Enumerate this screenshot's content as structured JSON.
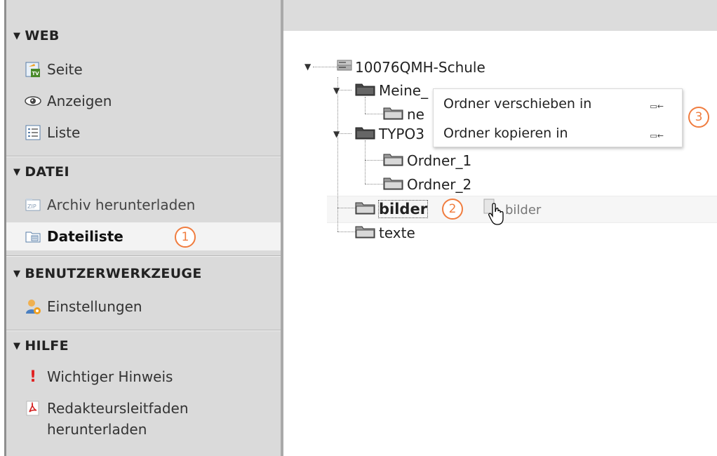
{
  "sidebar": {
    "sections": [
      {
        "title": "WEB",
        "items": [
          {
            "label": "Seite",
            "icon": "page-module-icon"
          },
          {
            "label": "Anzeigen",
            "icon": "eye-icon"
          },
          {
            "label": "Liste",
            "icon": "list-icon"
          }
        ]
      },
      {
        "title": "DATEI",
        "items": [
          {
            "label": "Archiv herunterladen",
            "icon": "zip-archive-icon"
          },
          {
            "label": "Dateiliste",
            "icon": "filelist-icon",
            "active": true
          }
        ]
      },
      {
        "title": "BENUTZERWERKZEUGE",
        "items": [
          {
            "label": "Einstellungen",
            "icon": "user-settings-icon"
          }
        ]
      },
      {
        "title": "HILFE",
        "items": [
          {
            "label": "Wichtiger Hinweis",
            "icon": "exclamation-icon"
          },
          {
            "label_line1": "Redakteursleitfaden",
            "label_line2": "herunterladen",
            "icon": "pdf-icon"
          }
        ]
      }
    ]
  },
  "tree": {
    "root": "10076QMH-Schule",
    "meine_dateien": "Meine_Dateien",
    "meine_partial": "Meine_",
    "neu_partial": "ne",
    "typo3": "TYPO3",
    "ordner1": "Ordner_1",
    "ordner2": "Ordner_2",
    "bilder": "bilder",
    "texte": "texte",
    "drag_label": "bilder"
  },
  "context_menu": {
    "items": [
      {
        "label": "Ordner verschieben in",
        "icon": "folder-move-icon"
      },
      {
        "label": "Ordner kopieren in",
        "icon": "folder-copy-icon"
      }
    ]
  },
  "badges": [
    "1",
    "2",
    "3"
  ],
  "colors": {
    "badge": "#f07c3e",
    "sidebar_bg": "#dadada",
    "active_bg": "#f3f3f3"
  }
}
